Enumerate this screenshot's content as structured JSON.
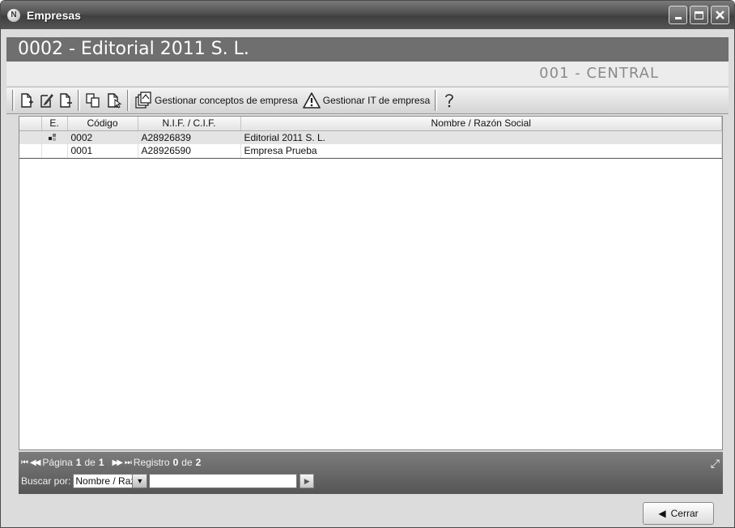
{
  "window": {
    "title": "Empresas",
    "app_icon": "N"
  },
  "company_header": "0002 - Editorial 2011 S. L.",
  "center_header": "001 - CENTRAL",
  "toolbar": {
    "manage_concepts_label": "Gestionar conceptos de empresa",
    "manage_it_label": "Gestionar IT de empresa"
  },
  "grid": {
    "columns": [
      "E.",
      "Código",
      "N.I.F. / C.I.F.",
      "Nombre / Razón Social"
    ],
    "rows": [
      {
        "code": "0002",
        "nif": "A28926839",
        "name": "Editorial 2011 S. L.",
        "status_icon": "active-status-icon"
      },
      {
        "code": "0001",
        "nif": "A28926590",
        "name": "Empresa Prueba",
        "status_icon": ""
      }
    ]
  },
  "pager": {
    "page_label": "Página",
    "page": "1",
    "of_label": "de",
    "page_total": "1",
    "record_label": "Registro",
    "record": "0",
    "record_of_label": "de",
    "record_total": "2",
    "search_label": "Buscar por:",
    "search_field": "Nombre / Razón Social",
    "search_field_shown": "Nombre / Razo",
    "search_value": ""
  },
  "footer": {
    "close_label": "Cerrar"
  },
  "colors": {
    "title_bar": "#4f4f4f",
    "header_bar": "#6f6f6f",
    "pager_bar": "#5f5f5f"
  }
}
